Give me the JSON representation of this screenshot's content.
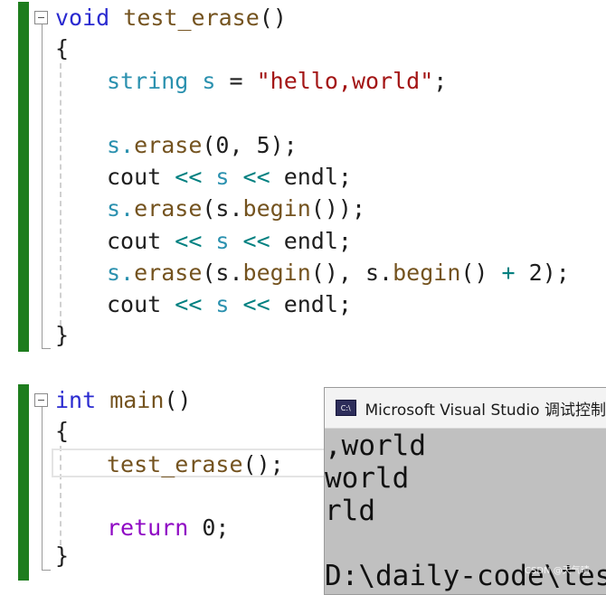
{
  "editor": {
    "block1": {
      "signature": {
        "keyword": "void",
        "name": " test_erase",
        "parens": "()"
      },
      "open_brace": "{",
      "line_decl": {
        "type": "string",
        "var": " s ",
        "eq": "=",
        "space": " ",
        "literal": "\"hello,world\"",
        "end": ";"
      },
      "line_erase1": {
        "obj": "s.",
        "fn": "erase",
        "args": "(0, 5);"
      },
      "line_cout1": {
        "cout": "cout ",
        "op1": "<<",
        "mid": " s ",
        "op2": "<<",
        "endl": " endl;"
      },
      "line_erase2": {
        "obj": "s.",
        "fn": "erase",
        "p1": "(s.",
        "fn2": "begin",
        "p2": "());"
      },
      "line_cout2": {
        "cout": "cout ",
        "op1": "<<",
        "mid": " s ",
        "op2": "<<",
        "endl": " endl;"
      },
      "line_erase3": {
        "obj": "s.",
        "fn": "erase",
        "p1": "(s.",
        "fn2": "begin",
        "p2": "(), s.",
        "fn3": "begin",
        "p3": "() ",
        "plus": "+",
        "p4": " 2);"
      },
      "line_cout3": {
        "cout": "cout ",
        "op1": "<<",
        "mid": " s ",
        "op2": "<<",
        "endl": " endl;"
      },
      "close_brace": "}"
    },
    "block2": {
      "signature": {
        "keyword": "int",
        "name": " main",
        "parens": "()"
      },
      "open_brace": "{",
      "line_call": {
        "fn": "test_erase",
        "rest": "();"
      },
      "line_return": {
        "kw": "return",
        "rest": " 0;"
      },
      "close_brace": "}"
    }
  },
  "console": {
    "title": "Microsoft Visual Studio 调试控制台",
    "icon_label": "C:\\",
    "output": [
      ",world",
      "world",
      "rld",
      "",
      "D:\\daily-code\\test"
    ]
  },
  "watermark": "CSDN @天气晴",
  "colors": {
    "keyword": "#2a2ad0",
    "type": "#2b91af",
    "string": "#a31515",
    "operator": "#008080",
    "control": "#8f08c4",
    "function": "#74531f",
    "change_bar": "#1e7d1e",
    "console_bg": "#c0c0c0"
  }
}
